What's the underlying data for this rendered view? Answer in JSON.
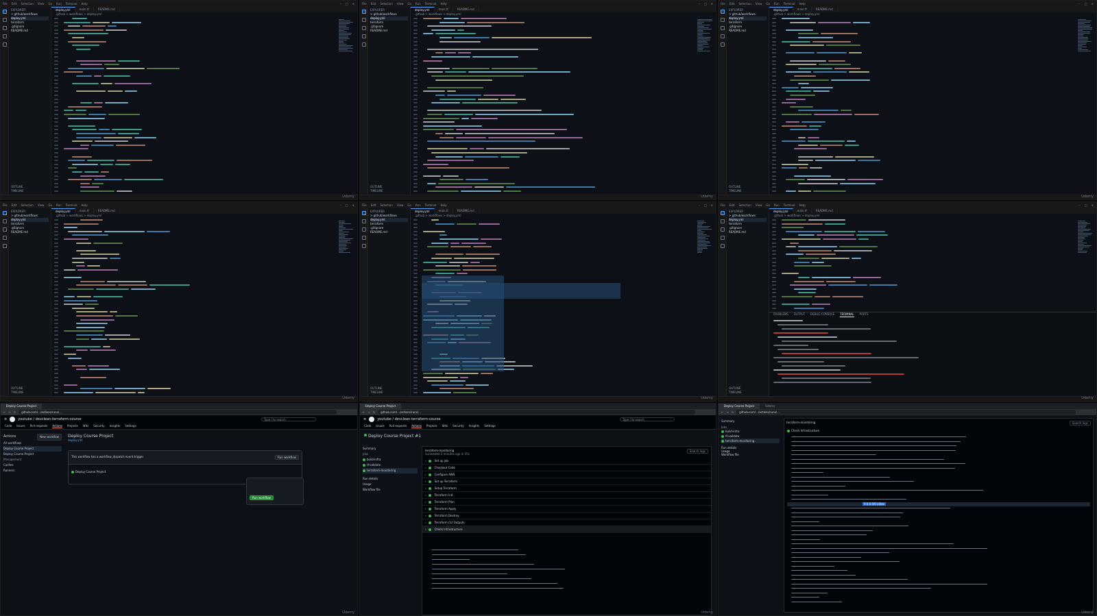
{
  "vscode": {
    "menu": [
      "File",
      "Edit",
      "Selection",
      "View",
      "Go",
      "Run",
      "Terminal",
      "Help"
    ],
    "explorer_header": "EXPLORER",
    "explorer_items": [
      "> github/workflows",
      "  deploy.yml",
      "  terraform",
      "  .gitignore",
      "  README.md"
    ],
    "outline_label": "OUTLINE",
    "timeline_label": "TIMELINE",
    "tabs": [
      "deploy.yml",
      "main.tf",
      "README.md"
    ],
    "breadcrumb": ".github > workflows > deploy.yml",
    "terminal_tabs": [
      "PROBLEMS",
      "OUTPUT",
      "DEBUG CONSOLE",
      "TERMINAL",
      "PORTS"
    ],
    "watermark": "Udemy"
  },
  "browser": {
    "tabs": [
      "Deploy Course Project",
      "Deploy Course Project",
      "Udemy"
    ],
    "url": "github.com/.../actions/runs/..."
  },
  "github": {
    "repo": "youtube / devclean-terraform-course",
    "search_placeholder": "Type / to search",
    "nav": [
      "Code",
      "Issues",
      "Pull requests",
      "Actions",
      "Projects",
      "Wiki",
      "Security",
      "Insights",
      "Settings"
    ],
    "actions_title": "Actions",
    "new_workflow": "New workflow",
    "all_workflows": "All workflows",
    "sidebar_workflows": [
      "Deploy Course Project",
      "Deploy Course Project"
    ],
    "management": "Management",
    "caches": "Caches",
    "runners": "Runners",
    "workflow_title": "Deploy Course Project",
    "workflow_file": "deploy.yml",
    "run_notice": "This workflow has a workflow_dispatch event trigger.",
    "run_workflow_btn": "Run workflow",
    "run_title": "Deploy Course Project",
    "run_popup_green": "Run workflow",
    "run_detail_title": "Deploy Course Project #1",
    "summary": "Summary",
    "jobs_label": "Jobs",
    "jobs": [
      "build-infra",
      "tf-validate",
      "terraform-monitoring"
    ],
    "run_details": "Run details",
    "usage": "Usage",
    "workflow_file_link": "Workflow file",
    "job_header": "terraform-monitoring",
    "job_sub": "succeeded 2 minutes ago in 35s",
    "search_logs": "Search logs",
    "steps": [
      "Set up job",
      "Checkout Code",
      "Configure AWS",
      "Set up Terraform",
      "Setup Terraform",
      "Terraform Init",
      "Terraform Plan",
      "Terraform Apply",
      "Terraform Destroy",
      "Terraform CLI Outputs",
      "Check Infrastructure"
    ],
    "logs_job_title": "terraform-monitoring",
    "logs_step": "Check Infrastructure",
    "logs_highlight": "0.0.0.0/0 allow"
  }
}
